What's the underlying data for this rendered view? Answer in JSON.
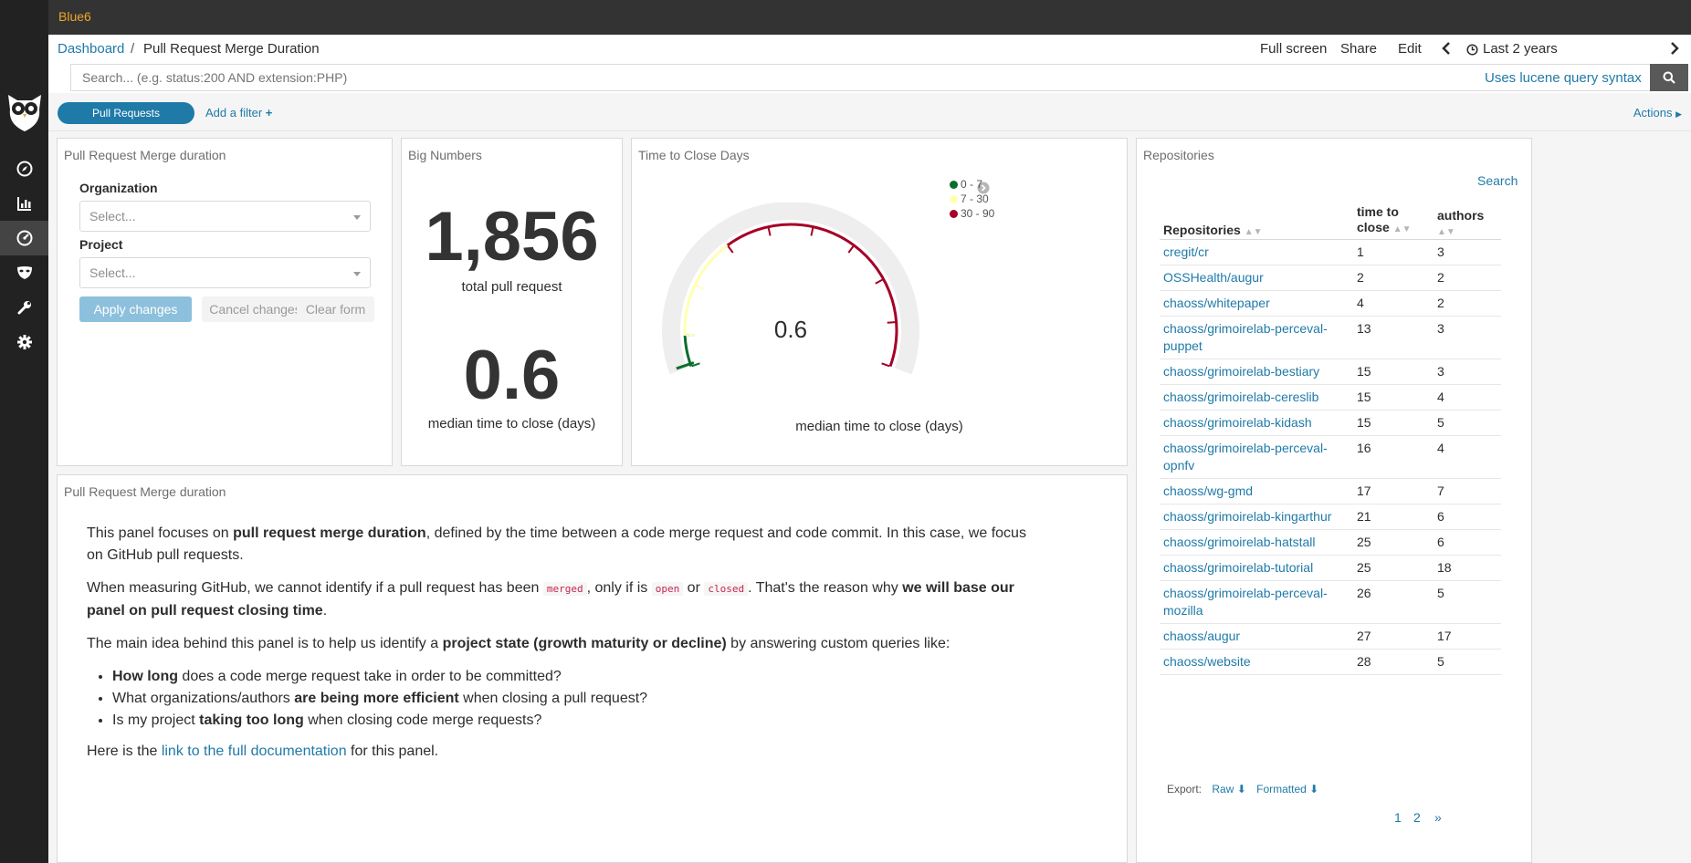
{
  "app": {
    "brand": "Blue6"
  },
  "breadcrumb": {
    "root": "Dashboard",
    "separator": "/",
    "current": "Pull Request Merge Duration"
  },
  "top_menu": {
    "full_screen": "Full screen",
    "share": "Share",
    "edit": "Edit",
    "time_range": "Last 2 years"
  },
  "search": {
    "placeholder": "Search... (e.g. status:200 AND extension:PHP)",
    "lucene_link": "Uses lucene query syntax"
  },
  "filters": {
    "pill": "Pull Requests",
    "add_filter": "Add a filter",
    "actions": "Actions"
  },
  "controls_panel": {
    "title": "Pull Request Merge duration",
    "organization_label": "Organization",
    "organization_placeholder": "Select...",
    "project_label": "Project",
    "project_placeholder": "Select...",
    "apply": "Apply changes",
    "cancel": "Cancel changes",
    "clear": "Clear form"
  },
  "big_numbers": {
    "title": "Big Numbers",
    "total": "1,856",
    "total_label": "total pull request",
    "median": "0.6",
    "median_label": "median time to close (days)"
  },
  "gauge": {
    "title": "Time to Close Days",
    "value": 0.6,
    "value_text": "0.6",
    "max": 90,
    "caption": "median time to close (days)",
    "ranges": [
      {
        "label": "0 - 7",
        "from": 0,
        "to": 7,
        "color": "#0a6e2c"
      },
      {
        "label": "7 - 30",
        "from": 7,
        "to": 30,
        "color": "#ffffb3"
      },
      {
        "label": "30 - 90",
        "from": 30,
        "to": 90,
        "color": "#a50026"
      }
    ]
  },
  "repositories": {
    "title": "Repositories",
    "search": "Search",
    "columns": {
      "repo": "Repositories",
      "time": "time to close",
      "authors": "authors"
    },
    "rows": [
      {
        "repo": "cregit/cr",
        "time": "1",
        "authors": "3"
      },
      {
        "repo": "OSSHealth/augur",
        "time": "2",
        "authors": "2"
      },
      {
        "repo": "chaoss/whitepaper",
        "time": "4",
        "authors": "2"
      },
      {
        "repo": "chaoss/grimoirelab-perceval-puppet",
        "time": "13",
        "authors": "3"
      },
      {
        "repo": "chaoss/grimoirelab-bestiary",
        "time": "15",
        "authors": "3"
      },
      {
        "repo": "chaoss/grimoirelab-cereslib",
        "time": "15",
        "authors": "4"
      },
      {
        "repo": "chaoss/grimoirelab-kidash",
        "time": "15",
        "authors": "5"
      },
      {
        "repo": "chaoss/grimoirelab-perceval-opnfv",
        "time": "16",
        "authors": "4"
      },
      {
        "repo": "chaoss/wg-gmd",
        "time": "17",
        "authors": "7"
      },
      {
        "repo": "chaoss/grimoirelab-kingarthur",
        "time": "21",
        "authors": "6"
      },
      {
        "repo": "chaoss/grimoirelab-hatstall",
        "time": "25",
        "authors": "6"
      },
      {
        "repo": "chaoss/grimoirelab-tutorial",
        "time": "25",
        "authors": "18"
      },
      {
        "repo": "chaoss/grimoirelab-perceval-mozilla",
        "time": "26",
        "authors": "5"
      },
      {
        "repo": "chaoss/augur",
        "time": "27",
        "authors": "17"
      },
      {
        "repo": "chaoss/website",
        "time": "28",
        "authors": "5"
      }
    ],
    "export_label": "Export:",
    "export_raw": "Raw",
    "export_formatted": "Formatted",
    "pages": [
      "1",
      "2",
      "»"
    ]
  },
  "description": {
    "title": "Pull Request Merge duration",
    "p1_a": "This panel focuses on ",
    "p1_b": "pull request merge duration",
    "p1_c": ", defined by the time between a code merge request and code commit. In this case, we focus on GitHub pull requests.",
    "p2_a": "When measuring GitHub, we cannot identify if a pull request has been ",
    "p2_code1": "merged",
    "p2_b": ", only if is ",
    "p2_code2": "open",
    "p2_c": " or ",
    "p2_code3": "closed",
    "p2_d": ". That's the reason why ",
    "p2_e": "we will base our panel on pull request closing time",
    "p2_f": ".",
    "p3_a": "The main idea behind this panel is to help us identify a ",
    "p3_b": "project state (growth maturity or decline)",
    "p3_c": " by answering custom queries like:",
    "li1_a": "How long",
    "li1_b": " does a code merge request take in order to be committed?",
    "li2_a": "What organizations/authors ",
    "li2_b": "are being more efficient",
    "li2_c": " when closing a pull request?",
    "li3_a": "Is my project ",
    "li3_b": "taking too long",
    "li3_c": " when closing code merge requests?",
    "p4_a": "Here is the ",
    "p4_link": "link to the full documentation",
    "p4_b": " for this panel."
  },
  "icons": {
    "logo": "owl-logo-icon",
    "discover": "compass-icon",
    "visualize": "bar-chart-icon",
    "dashboard": "dashboard-gauge-icon",
    "timelion": "mask-icon",
    "devtools": "wrench-icon",
    "management": "gear-icon"
  },
  "colors": {
    "accent": "#1f7aa8",
    "brand": "#f0a52c",
    "sidebar": "#222222"
  }
}
